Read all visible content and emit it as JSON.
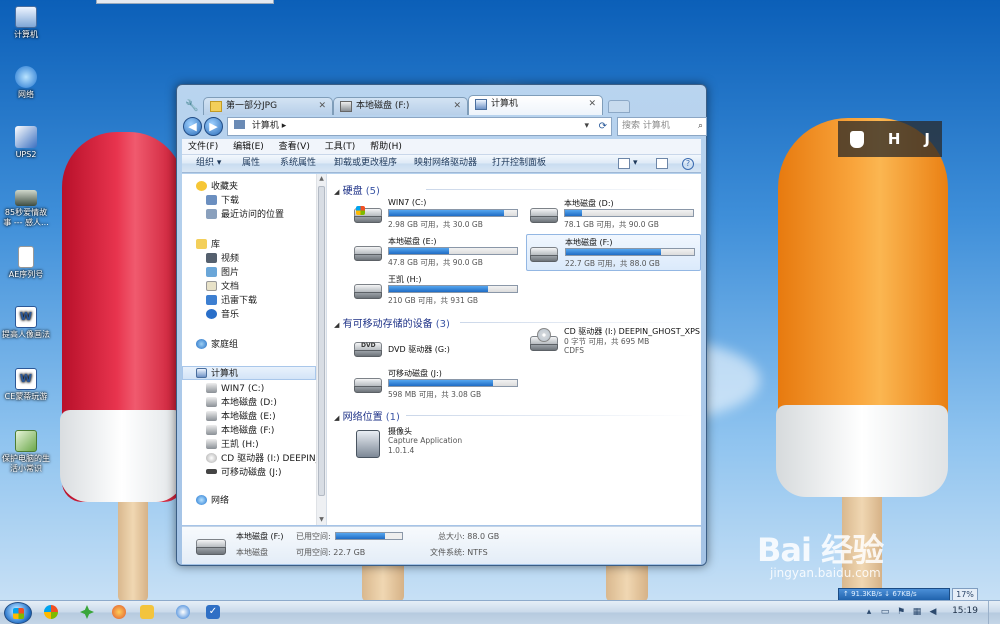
{
  "desktop": {
    "icons": [
      {
        "label": "计算机",
        "color": "#d9e6f7"
      },
      {
        "label": "网络",
        "color": "#3b90e0"
      },
      {
        "label": "UPS2",
        "color": "#3a6fc0"
      },
      {
        "label": "85秒爱情故事 --- 感人...",
        "color": "#4a5a50"
      },
      {
        "label": "AE序列号",
        "color": "#ffffff"
      },
      {
        "label": "提高人像画法",
        "color": "#e8eef8"
      },
      {
        "label": "CE蒙蒂玩游",
        "color": "#e8eef8"
      },
      {
        "label": "保护电脑的生活小常识",
        "color": "#6ba84a"
      }
    ],
    "widget": {
      "h": "H",
      "j": "J"
    },
    "watermark": {
      "brand": "Bai 经验",
      "url": "jingyan.baidu.com"
    }
  },
  "window": {
    "tabs": [
      {
        "label": "第一部分JPG",
        "active": false
      },
      {
        "label": "本地磁盘 (F:)",
        "active": false
      },
      {
        "label": "计算机",
        "active": true
      }
    ],
    "address": {
      "path": "计算机 ▸"
    },
    "search": {
      "placeholder": "搜索 计算机"
    },
    "menu": [
      "文件(F)",
      "编辑(E)",
      "查看(V)",
      "工具(T)",
      "帮助(H)"
    ],
    "commands": [
      "组织 ▾",
      "属性",
      "系统属性",
      "卸载或更改程序",
      "映射网络驱动器",
      "打开控制面板"
    ],
    "nav": {
      "favorites": "收藏夹",
      "fav_items": [
        "下载",
        "最近访问的位置"
      ],
      "libraries": "库",
      "lib_items": [
        "视频",
        "图片",
        "文档",
        "迅雷下载",
        "音乐"
      ],
      "homegroup": "家庭组",
      "computer": "计算机",
      "computer_items": [
        "WIN7 (C:)",
        "本地磁盘 (D:)",
        "本地磁盘 (E:)",
        "本地磁盘 (F:)",
        "王凯 (H:)",
        "CD 驱动器 (I:) DEEPIN_GHOST",
        "可移动磁盘 (J:)"
      ],
      "network": "网络"
    },
    "sections": {
      "hdd": {
        "title": "硬盘",
        "count": "(5)"
      },
      "removable": {
        "title": "有可移动存储的设备",
        "count": "(3)"
      },
      "network": {
        "title": "网络位置",
        "count": "(1)"
      }
    },
    "drives": [
      {
        "name": "WIN7 (C:)",
        "stat": "2.98 GB 可用，共 30.0 GB",
        "used": 0.9,
        "system": true
      },
      {
        "name": "本地磁盘 (D:)",
        "stat": "78.1 GB 可用，共 90.0 GB",
        "used": 0.13
      },
      {
        "name": "本地磁盘 (E:)",
        "stat": "47.8 GB 可用，共 90.0 GB",
        "used": 0.47
      },
      {
        "name": "本地磁盘 (F:)",
        "stat": "22.7 GB 可用，共 88.0 GB",
        "used": 0.74,
        "selected": true
      },
      {
        "name": "王凯 (H:)",
        "stat": "210 GB 可用，共 931 GB",
        "used": 0.77
      }
    ],
    "removables": [
      {
        "name": "DVD 驱动器 (G:)",
        "icon": "DVD"
      },
      {
        "name": "CD 驱动器 (I:) DEEPIN_GHOST_XPS",
        "stat1": "0 字节 可用，共 695 MB",
        "stat2": "CDFS"
      },
      {
        "name": "可移动磁盘 (J:)",
        "stat": "598 MB 可用，共 3.08 GB",
        "used": 0.81
      }
    ],
    "netloc": {
      "name": "摄像头",
      "line1": "Capture Application",
      "line2": "1.0.1.4"
    },
    "details": {
      "name": "本地磁盘 (F:)",
      "used_label": "已用空间:",
      "total": "总大小: 88.0 GB",
      "type": "本地磁盘",
      "free": "可用空间: 22.7 GB",
      "fs": "文件系统: NTFS",
      "used": 0.74
    }
  },
  "taskbar": {
    "clock": "15:19",
    "net": "↑ 91.3KB/s  ↓ 67KB/s",
    "percent": "17%"
  }
}
